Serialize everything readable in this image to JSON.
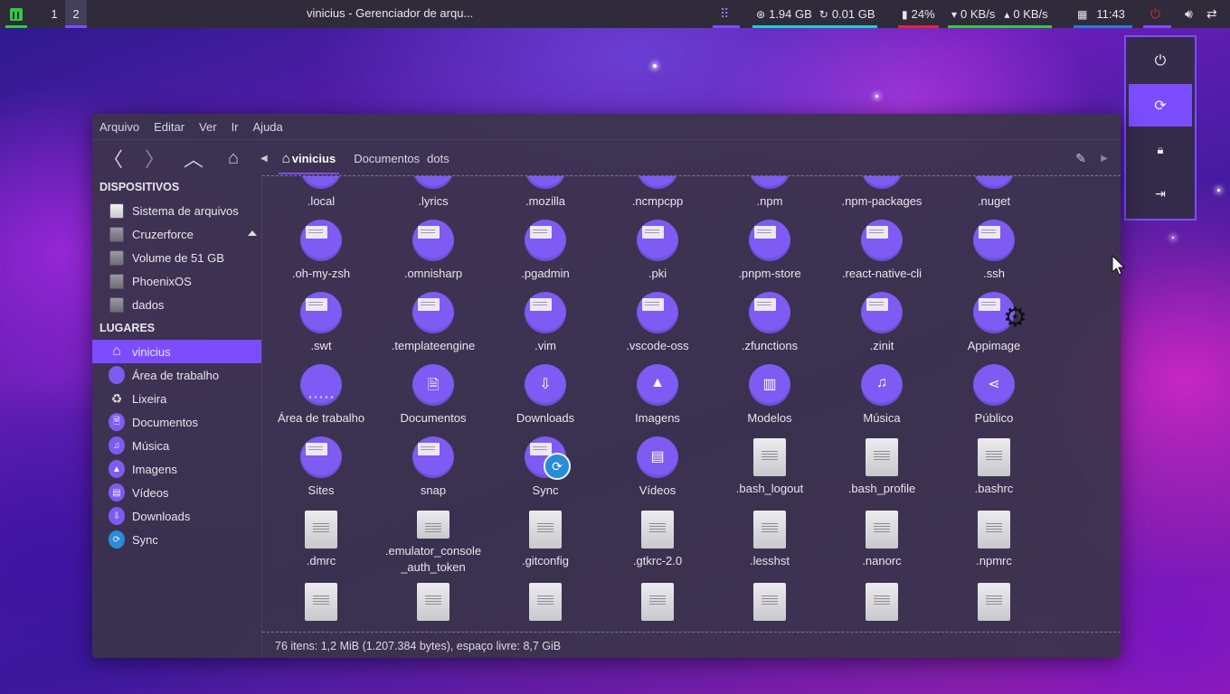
{
  "topbar": {
    "workspaces": [
      "1",
      "2"
    ],
    "window_title": "vinicius - Gerenciador de arqu...",
    "memory": "1.94 GB",
    "swap": "0.01 GB",
    "battery": "24%",
    "net_down": "0 KB/s",
    "net_up": "0 KB/s",
    "clock": "11:43",
    "accent_colors": [
      "#2ecc40",
      "#7c4dff",
      "#1fd0d0",
      "#e0283a",
      "#2ecc40",
      "#7c4dff"
    ]
  },
  "power_menu": {
    "icons": [
      "power-icon",
      "refresh-icon",
      "lock-icon",
      "logout-icon"
    ]
  },
  "file_manager": {
    "menu": [
      "Arquivo",
      "Editar",
      "Ver",
      "Ir",
      "Ajuda"
    ],
    "breadcrumbs": [
      "vinicius",
      "Documentos",
      "dots"
    ],
    "sidebar": {
      "devices_heading": "DISPOSITIVOS",
      "devices": [
        "Sistema de arquivos",
        "Cruzerforce",
        "Volume de 51 GB",
        "PhoenixOS",
        "dados"
      ],
      "places_heading": "LUGARES",
      "places": [
        "vinicius",
        "Área de trabalho",
        "Lixeira",
        "Documentos",
        "Música",
        "Imagens",
        "Vídeos",
        "Downloads",
        "Sync"
      ]
    },
    "files": [
      {
        "name": ".local",
        "type": "folder"
      },
      {
        "name": ".lyrics",
        "type": "folder"
      },
      {
        "name": ".mozilla",
        "type": "folder"
      },
      {
        "name": ".ncmpcpp",
        "type": "folder"
      },
      {
        "name": ".npm",
        "type": "folder"
      },
      {
        "name": ".npm-packages",
        "type": "folder"
      },
      {
        "name": ".nuget",
        "type": "folder"
      },
      {
        "name": ".oh-my-zsh",
        "type": "folder"
      },
      {
        "name": ".omnisharp",
        "type": "folder"
      },
      {
        "name": ".pgadmin",
        "type": "folder"
      },
      {
        "name": ".pki",
        "type": "folder"
      },
      {
        "name": ".pnpm-store",
        "type": "folder"
      },
      {
        "name": ".react-native-cli",
        "type": "folder"
      },
      {
        "name": ".ssh",
        "type": "folder"
      },
      {
        "name": ".swt",
        "type": "folder"
      },
      {
        "name": ".templateengine",
        "type": "folder"
      },
      {
        "name": ".vim",
        "type": "folder"
      },
      {
        "name": ".vscode-oss",
        "type": "folder"
      },
      {
        "name": ".zfunctions",
        "type": "folder"
      },
      {
        "name": ".zinit",
        "type": "folder"
      },
      {
        "name": "Appimage",
        "type": "folder",
        "emblem": "gear"
      },
      {
        "name": "Área de trabalho",
        "type": "desktop"
      },
      {
        "name": "Documentos",
        "type": "special",
        "glyph": "🗎"
      },
      {
        "name": "Downloads",
        "type": "special",
        "glyph": "⇩"
      },
      {
        "name": "Imagens",
        "type": "special",
        "glyph": "▲"
      },
      {
        "name": "Modelos",
        "type": "special",
        "glyph": "▥"
      },
      {
        "name": "Música",
        "type": "special",
        "glyph": "♫"
      },
      {
        "name": "Público",
        "type": "special",
        "glyph": "⋖"
      },
      {
        "name": "Sites",
        "type": "folder"
      },
      {
        "name": "snap",
        "type": "folder"
      },
      {
        "name": "Sync",
        "type": "folder",
        "emblem": "sync"
      },
      {
        "name": "Vídeos",
        "type": "special",
        "glyph": "▤"
      },
      {
        "name": ".bash_logout",
        "type": "file"
      },
      {
        "name": ".bash_profile",
        "type": "file"
      },
      {
        "name": ".bashrc",
        "type": "file"
      },
      {
        "name": ".dmrc",
        "type": "file"
      },
      {
        "name": ".emulator_console _auth_token",
        "type": "file"
      },
      {
        "name": ".gitconfig",
        "type": "file"
      },
      {
        "name": ".gtkrc-2.0",
        "type": "file"
      },
      {
        "name": ".lesshst",
        "type": "file"
      },
      {
        "name": ".nanorc",
        "type": "file"
      },
      {
        "name": ".npmrc",
        "type": "file"
      },
      {
        "name": "",
        "type": "file"
      },
      {
        "name": "",
        "type": "file"
      },
      {
        "name": "",
        "type": "file"
      },
      {
        "name": "",
        "type": "file"
      },
      {
        "name": "",
        "type": "file"
      },
      {
        "name": "",
        "type": "file"
      },
      {
        "name": "",
        "type": "file"
      }
    ],
    "status": "76 itens: 1,2 MiB (1.207.384 bytes), espaço livre: 8,7 GiB",
    "accent": "#7c4dff",
    "folder_color": "#7e5bf2"
  }
}
